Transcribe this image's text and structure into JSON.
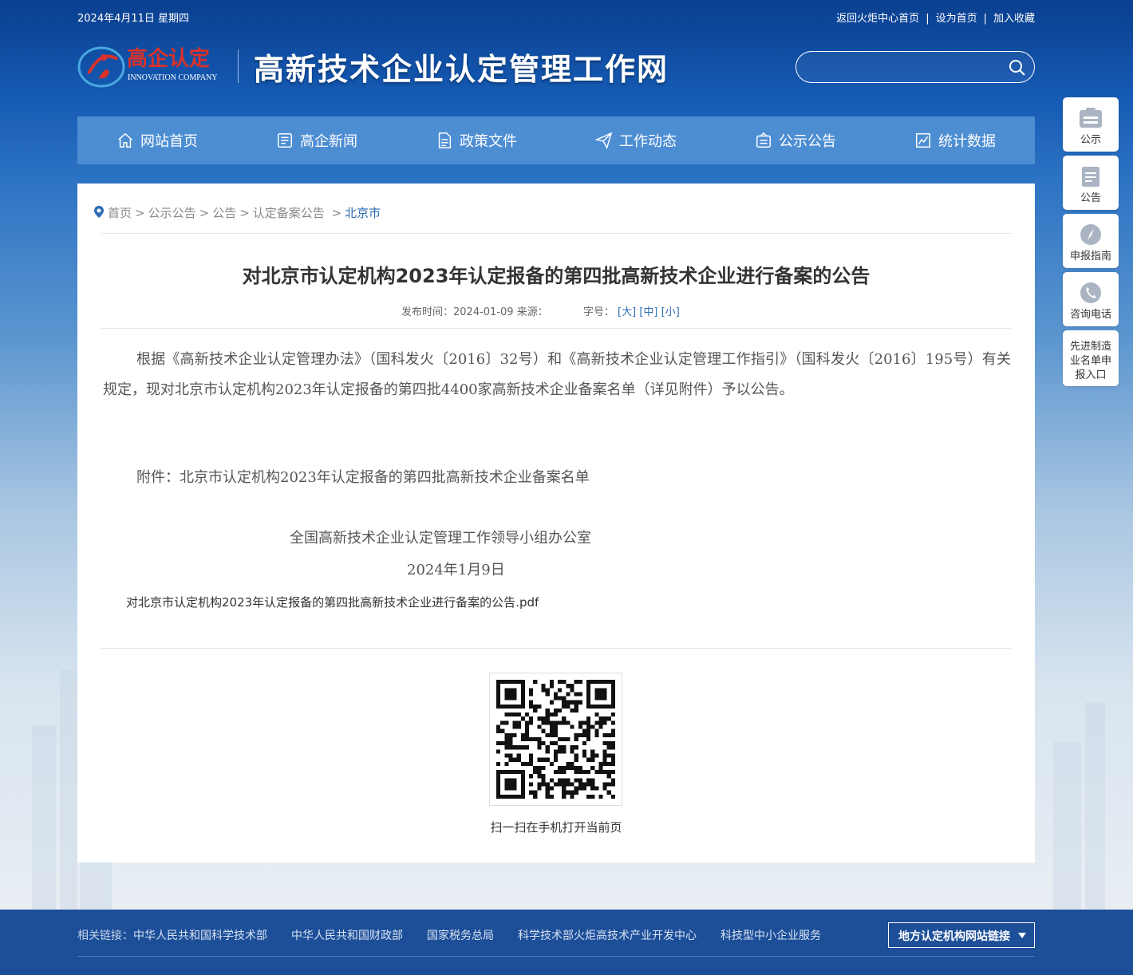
{
  "topbar": {
    "date": "2024年4月11日 星期四",
    "links": [
      "返回火炬中心首页",
      "设为首页",
      "加入收藏"
    ]
  },
  "logo": {
    "text_cn": "高企认定",
    "text_en": "INNOVATION COMPANY"
  },
  "site_title": "高新技术企业认定管理工作网",
  "search": {
    "placeholder": ""
  },
  "nav": [
    {
      "label": "网站首页",
      "icon": "home-icon"
    },
    {
      "label": "高企新闻",
      "icon": "news-icon"
    },
    {
      "label": "政策文件",
      "icon": "document-icon"
    },
    {
      "label": "工作动态",
      "icon": "send-icon"
    },
    {
      "label": "公示公告",
      "icon": "notice-icon"
    },
    {
      "label": "统计数据",
      "icon": "chart-icon"
    }
  ],
  "sidebar": [
    {
      "label": "公示",
      "icon": "publicity-icon"
    },
    {
      "label": "公告",
      "icon": "announcement-icon"
    },
    {
      "label": "申报指南",
      "icon": "compass-icon"
    },
    {
      "label": "咨询电话",
      "icon": "phone-icon"
    },
    {
      "label": "先进制造业名单申报入口",
      "icon": ""
    }
  ],
  "breadcrumb": [
    "首页",
    "公示公告",
    "公告",
    "认定备案公告",
    "北京市"
  ],
  "article": {
    "title": "对北京市认定机构2023年认定报备的第四批高新技术企业进行备案的公告",
    "publish_label": "发布时间：",
    "publish_date": "2024-01-09",
    "source_label": "来源：",
    "source": "",
    "font_size_label": "字号：",
    "font_sizes": [
      "[大]",
      "[中]",
      "[小]"
    ],
    "body": "根据《高新技术企业认定管理办法》（国科发火〔2016〕32号）和《高新技术企业认定管理工作指引》（国科发火〔2016〕195号）有关规定，现对北京市认定机构2023年认定报备的第四批4400家高新技术企业备案名单（详见附件）予以公告。",
    "attachment": "附件：北京市认定机构2023年认定报备的第四批高新技术企业备案名单",
    "signature_org": "全国高新技术企业认定管理工作领导小组办公室",
    "signature_date": "2024年1月9日",
    "pdf_link": "对北京市认定机构2023年认定报备的第四批高新技术企业进行备案的公告.pdf"
  },
  "qr": {
    "caption": "扫一扫在手机打开当前页"
  },
  "footer": {
    "label": "相关链接：",
    "links": [
      "中华人民共和国科学技术部",
      "中华人民共和国财政部",
      "国家税务总局",
      "科学技术部火炬高技术产业开发中心",
      "科技型中小企业服务"
    ],
    "select": "地方认定机构网站链接"
  },
  "colors": {
    "nav_bg": "#4d8ed3",
    "link_blue": "#2e6db4",
    "footer_bg": "#1d4f99",
    "logo_red": "#d9312b"
  }
}
